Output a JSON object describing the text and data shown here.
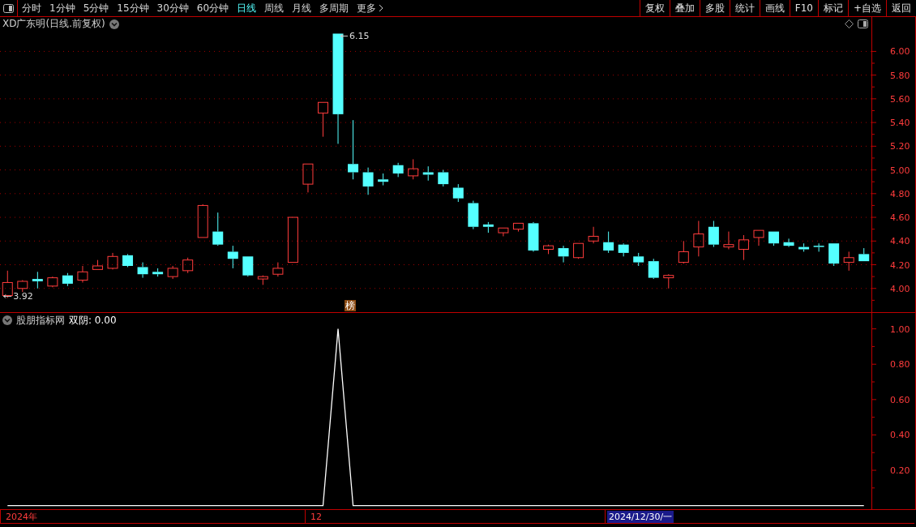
{
  "toolbar": {
    "periods": [
      {
        "label": "分时",
        "selected": false
      },
      {
        "label": "1分钟",
        "selected": false
      },
      {
        "label": "5分钟",
        "selected": false
      },
      {
        "label": "15分钟",
        "selected": false
      },
      {
        "label": "30分钟",
        "selected": false
      },
      {
        "label": "60分钟",
        "selected": false
      },
      {
        "label": "日线",
        "selected": true
      },
      {
        "label": "周线",
        "selected": false
      },
      {
        "label": "月线",
        "selected": false
      },
      {
        "label": "多周期",
        "selected": false
      },
      {
        "label": "更多",
        "selected": false
      }
    ],
    "actions": [
      "复权",
      "叠加",
      "多股",
      "统计",
      "画线",
      "F10",
      "标记",
      "+自选",
      "返回"
    ]
  },
  "main_chart": {
    "title": "XD广东明(日线.前复权)",
    "high_label": "6.15",
    "low_label": "3.92",
    "marker": "榜",
    "chart_data": {
      "type": "candlestick",
      "grid": true,
      "ylim": [
        3.8,
        6.29
      ],
      "yticks": [
        {
          "value": 4.0,
          "label": "4.00"
        },
        {
          "value": 4.2,
          "label": "4.20"
        },
        {
          "value": 4.4,
          "label": "4.40"
        },
        {
          "value": 4.6,
          "label": "4.60"
        },
        {
          "value": 4.8,
          "label": "4.80"
        },
        {
          "value": 5.0,
          "label": "5.00"
        },
        {
          "value": 5.2,
          "label": "5.20"
        },
        {
          "value": 5.4,
          "label": "5.40"
        },
        {
          "value": 5.6,
          "label": "5.60"
        },
        {
          "value": 5.8,
          "label": "5.80"
        },
        {
          "value": 6.0,
          "label": "6.00"
        }
      ],
      "categories": [
        null,
        null,
        null,
        null,
        null,
        null,
        null,
        null,
        null,
        null,
        null,
        null,
        null,
        null,
        null,
        null,
        null,
        null,
        null,
        null,
        null,
        null,
        null,
        null,
        null,
        null,
        null,
        null,
        null,
        null,
        null,
        null,
        null,
        null,
        null,
        null,
        null,
        null,
        null,
        null,
        null,
        null,
        null,
        null,
        null,
        null,
        null,
        null,
        null,
        null,
        null,
        null,
        null,
        null,
        null,
        null,
        null,
        null
      ],
      "ohlc": [
        [
          3.94,
          4.15,
          3.92,
          4.05
        ],
        [
          4.0,
          4.07,
          3.97,
          4.06
        ],
        [
          4.08,
          4.14,
          4.0,
          4.06
        ],
        [
          4.02,
          4.1,
          4.01,
          4.09
        ],
        [
          4.11,
          4.13,
          4.02,
          4.04
        ],
        [
          4.07,
          4.19,
          4.05,
          4.14
        ],
        [
          4.16,
          4.24,
          4.16,
          4.19
        ],
        [
          4.17,
          4.3,
          4.16,
          4.27
        ],
        [
          4.28,
          4.29,
          4.18,
          4.19
        ],
        [
          4.18,
          4.22,
          4.09,
          4.12
        ],
        [
          4.14,
          4.17,
          4.1,
          4.12
        ],
        [
          4.1,
          4.19,
          4.08,
          4.17
        ],
        [
          4.15,
          4.26,
          4.13,
          4.24
        ],
        [
          4.43,
          4.71,
          4.43,
          4.7
        ],
        [
          4.48,
          4.64,
          4.36,
          4.37
        ],
        [
          4.31,
          4.36,
          4.17,
          4.25
        ],
        [
          4.27,
          4.27,
          4.1,
          4.11
        ],
        [
          4.08,
          4.11,
          4.03,
          4.1
        ],
        [
          4.12,
          4.22,
          4.1,
          4.17
        ],
        [
          4.22,
          4.6,
          4.22,
          4.6
        ],
        [
          4.88,
          5.05,
          4.81,
          5.05
        ],
        [
          5.48,
          5.57,
          5.28,
          5.57
        ],
        [
          6.15,
          6.15,
          5.22,
          5.47
        ],
        [
          5.05,
          5.42,
          4.92,
          4.98
        ],
        [
          4.98,
          5.02,
          4.79,
          4.86
        ],
        [
          4.92,
          4.97,
          4.87,
          4.9
        ],
        [
          5.04,
          5.06,
          4.94,
          4.97
        ],
        [
          4.95,
          5.09,
          4.92,
          5.01
        ],
        [
          4.98,
          5.03,
          4.91,
          4.96
        ],
        [
          4.98,
          5.0,
          4.86,
          4.88
        ],
        [
          4.85,
          4.88,
          4.73,
          4.76
        ],
        [
          4.72,
          4.74,
          4.5,
          4.52
        ],
        [
          4.54,
          4.56,
          4.47,
          4.52
        ],
        [
          4.47,
          4.51,
          4.44,
          4.51
        ],
        [
          4.5,
          4.55,
          4.48,
          4.55
        ],
        [
          4.55,
          4.56,
          4.31,
          4.32
        ],
        [
          4.33,
          4.37,
          4.29,
          4.36
        ],
        [
          4.34,
          4.36,
          4.22,
          4.27
        ],
        [
          4.26,
          4.38,
          4.25,
          4.38
        ],
        [
          4.4,
          4.52,
          4.38,
          4.44
        ],
        [
          4.39,
          4.48,
          4.3,
          4.32
        ],
        [
          4.37,
          4.38,
          4.27,
          4.3
        ],
        [
          4.27,
          4.3,
          4.19,
          4.22
        ],
        [
          4.23,
          4.25,
          4.08,
          4.09
        ],
        [
          4.09,
          4.12,
          4.0,
          4.11
        ],
        [
          4.22,
          4.4,
          4.21,
          4.31
        ],
        [
          4.35,
          4.57,
          4.27,
          4.46
        ],
        [
          4.52,
          4.57,
          4.35,
          4.37
        ],
        [
          4.35,
          4.48,
          4.33,
          4.37
        ],
        [
          4.33,
          4.45,
          4.24,
          4.41
        ],
        [
          4.43,
          4.49,
          4.36,
          4.49
        ],
        [
          4.48,
          4.48,
          4.36,
          4.38
        ],
        [
          4.39,
          4.42,
          4.35,
          4.36
        ],
        [
          4.35,
          4.38,
          4.31,
          4.33
        ],
        [
          4.36,
          4.38,
          4.31,
          4.35
        ],
        [
          4.38,
          4.38,
          4.19,
          4.21
        ],
        [
          4.22,
          4.31,
          4.15,
          4.26
        ],
        [
          4.29,
          4.34,
          4.23,
          4.23
        ]
      ]
    }
  },
  "indicator": {
    "title": "股朋指标网",
    "reading": "双阴: 0.00",
    "chart_data": {
      "type": "line",
      "ylim": [
        -0.02,
        1.09
      ],
      "yticks": [
        {
          "value": 0.2,
          "label": "0.20"
        },
        {
          "value": 0.4,
          "label": "0.40"
        },
        {
          "value": 0.6,
          "label": "0.60"
        },
        {
          "value": 0.8,
          "label": "0.80"
        },
        {
          "value": 1.0,
          "label": "1.00"
        }
      ],
      "categories": [
        null,
        null,
        null,
        null,
        null,
        null,
        null,
        null,
        null,
        null,
        null,
        null,
        null,
        null,
        null,
        null,
        null,
        null,
        null,
        null,
        null,
        null,
        null,
        null,
        null,
        null,
        null,
        null,
        null,
        null,
        null,
        null,
        null,
        null,
        null,
        null,
        null,
        null,
        null,
        null,
        null,
        null,
        null,
        null,
        null,
        null,
        null,
        null,
        null,
        null,
        null,
        null,
        null,
        null,
        null,
        null,
        null,
        null
      ],
      "series": [
        {
          "color": "#ffffff",
          "values": [
            0,
            0,
            0,
            0,
            0,
            0,
            0,
            0,
            0,
            0,
            0,
            0,
            0,
            0,
            0,
            0,
            0,
            0,
            0,
            0,
            0,
            0,
            1,
            0,
            0,
            0,
            0,
            0,
            0,
            0,
            0,
            0,
            0,
            0,
            0,
            0,
            0,
            0,
            0,
            0,
            0,
            0,
            0,
            0,
            0,
            0,
            0,
            0,
            0,
            0,
            0,
            0,
            0,
            0,
            0,
            0,
            0,
            0
          ]
        }
      ]
    }
  },
  "date_bar": {
    "year": "2024年",
    "month": "12",
    "cursor_date": "2024/12/30/一"
  }
}
